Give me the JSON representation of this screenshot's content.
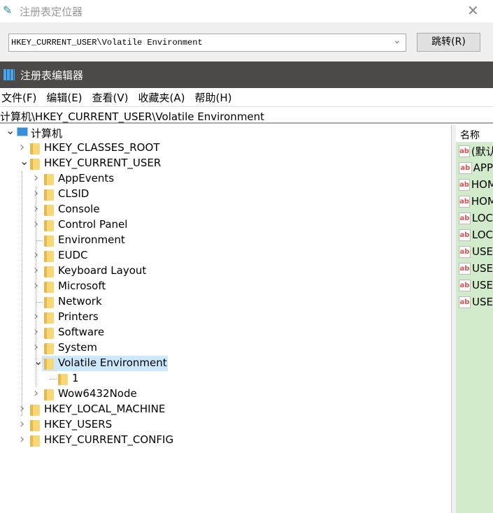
{
  "locator": {
    "title": "注册表定位器",
    "path": "HKEY_CURRENT_USER\\Volatile Environment",
    "go_label": "跳转(R)"
  },
  "editor": {
    "title": "注册表编辑器"
  },
  "menu": [
    "文件(F)",
    "编辑(E)",
    "查看(V)",
    "收藏夹(A)",
    "帮助(H)"
  ],
  "address": "计算机\\HKEY_CURRENT_USER\\Volatile Environment",
  "tree": [
    {
      "label": "计算机",
      "level": 0,
      "state": "expanded",
      "icon": "computer-icon"
    },
    {
      "label": "HKEY_CLASSES_ROOT",
      "level": 1,
      "state": "collapsed"
    },
    {
      "label": "HKEY_CURRENT_USER",
      "level": 1,
      "state": "expanded"
    },
    {
      "label": "AppEvents",
      "level": 2,
      "state": "collapsed"
    },
    {
      "label": "CLSID",
      "level": 2,
      "state": "collapsed"
    },
    {
      "label": "Console",
      "level": 2,
      "state": "collapsed"
    },
    {
      "label": "Control Panel",
      "level": 2,
      "state": "collapsed"
    },
    {
      "label": "Environment",
      "level": 2,
      "state": "leaf"
    },
    {
      "label": "EUDC",
      "level": 2,
      "state": "collapsed"
    },
    {
      "label": "Keyboard Layout",
      "level": 2,
      "state": "collapsed"
    },
    {
      "label": "Microsoft",
      "level": 2,
      "state": "collapsed"
    },
    {
      "label": "Network",
      "level": 2,
      "state": "leaf"
    },
    {
      "label": "Printers",
      "level": 2,
      "state": "collapsed"
    },
    {
      "label": "Software",
      "level": 2,
      "state": "collapsed"
    },
    {
      "label": "System",
      "level": 2,
      "state": "collapsed"
    },
    {
      "label": "Volatile Environment",
      "level": 2,
      "state": "expanded",
      "selected": true
    },
    {
      "label": "1",
      "level": 3,
      "state": "leaf"
    },
    {
      "label": "Wow6432Node",
      "level": 2,
      "state": "collapsed"
    },
    {
      "label": "HKEY_LOCAL_MACHINE",
      "level": 1,
      "state": "collapsed"
    },
    {
      "label": "HKEY_USERS",
      "level": 1,
      "state": "collapsed"
    },
    {
      "label": "HKEY_CURRENT_CONFIG",
      "level": 1,
      "state": "collapsed"
    }
  ],
  "values_pane": {
    "header": "名称",
    "rows": [
      "(默认",
      "APP",
      "HOM",
      "HOM",
      "LOC",
      "LOC",
      "USE",
      "USE",
      "USE",
      "USE"
    ],
    "bg_color": "#d2eccb"
  },
  "colors": {
    "selection": "#cce8ff",
    "titlebar_dark": "#4b4a48"
  }
}
